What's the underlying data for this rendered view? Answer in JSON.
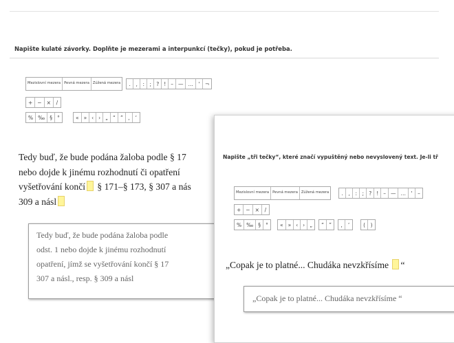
{
  "back": {
    "instruction": "Napište kulaté závorky. Doplňte je mezerami a interpunkcí (tečky), pokud je potřeba.",
    "keyboard": {
      "space_keys": [
        "Mezislovní mezera",
        "Pevná mezera",
        "Zúžená mezera"
      ],
      "punct": [
        ".",
        ",",
        ":",
        ";",
        "?",
        "!",
        "–",
        "—",
        "…",
        "'",
        "¬"
      ],
      "math": [
        "+",
        "−",
        "×",
        "/"
      ],
      "row3a": [
        "%",
        "‰",
        "§",
        "°"
      ],
      "row3b": [
        "«",
        "»",
        "‹",
        "›",
        "„",
        "“",
        "”",
        "‚",
        "‘"
      ]
    },
    "answer_lines": [
      "Tedy buď, že bude podána žaloba podle § 17",
      "nebo dojde k jinému rozhodnutí či opatření",
      "vyšetřování končí",
      " § 171–§ 173, § 307 a nás",
      "309 a násl"
    ],
    "result_lines": [
      "Tedy buď, že bude podána žaloba podle",
      "odst. 1 nebo dojde k jinému rozhodnutí",
      "opatření, jímž se vyšetřování končí  § 17",
      "307 a násl., resp. § 309 a násl"
    ]
  },
  "front": {
    "instruction": "Napište „tři tečky“, které značí vypuštěný nebo nevyslovený text. Je-li tř",
    "keyboard": {
      "space_keys": [
        "Mezislovní mezera",
        "Pevná mezera",
        "Zúžená mezera"
      ],
      "punct": [
        ".",
        ",",
        ":",
        ";",
        "?",
        "!",
        "–",
        "—",
        "…",
        "'",
        "–"
      ],
      "math": [
        "+",
        "−",
        "×",
        "/"
      ],
      "row3a": [
        "%",
        "‰",
        "§",
        "°"
      ],
      "row3b": [
        "«",
        "»",
        "‹",
        "›",
        "„"
      ],
      "row3c": [
        "“",
        "”"
      ],
      "row3d": [
        "‚",
        "‘"
      ],
      "row3e": [
        "(",
        ")"
      ]
    },
    "answer_before": "„Copak je to platné... Chudáka nevzkřísíme",
    "answer_after": "“",
    "result": "„Copak je to platné... Chudáka nevzkřísíme  “"
  },
  "colors": {
    "gap": "#fff59a",
    "border": "#a9a9a9"
  }
}
